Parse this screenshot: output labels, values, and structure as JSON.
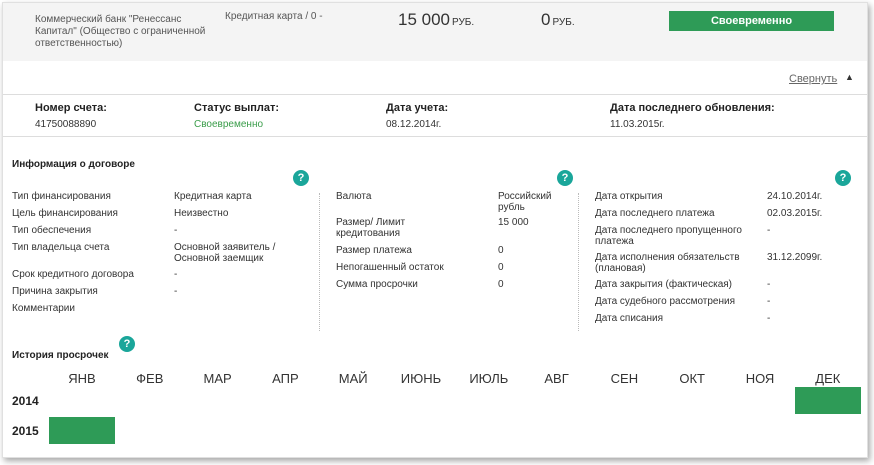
{
  "top": {
    "bank_name": "Коммерческий банк \"Ренессанс Капитал\" (Общество с ограниченной ответственностью)",
    "product": "Кредитная карта / 0 -",
    "limit_value": "15 000",
    "limit_currency": "РУБ.",
    "balance_value": "0",
    "balance_currency": "РУБ.",
    "status_button": "Своевременно"
  },
  "collapse_label": "Свернуть",
  "summary": {
    "account_label": "Номер счета:",
    "account_value": "41750088890",
    "status_label": "Статус выплат:",
    "status_value": "Своевременно",
    "date_label": "Дата учета:",
    "date_value": "08.12.2014г.",
    "updated_label": "Дата последнего обновления:",
    "updated_value": "11.03.2015г."
  },
  "contract": {
    "title": "Информация о договоре",
    "help_glyph": "?",
    "col1": [
      {
        "k": "Тип финансирования",
        "v": "Кредитная карта"
      },
      {
        "k": "Цель финансирования",
        "v": "Неизвестно"
      },
      {
        "k": "Тип обеспечения",
        "v": "-"
      },
      {
        "k": "Тип владельца счета",
        "v": "Основной заявитель / Основной заемщик"
      },
      {
        "k": "Срок кредитного договора",
        "v": "-"
      },
      {
        "k": "Причина закрытия",
        "v": "-"
      },
      {
        "k": "Комментарии",
        "v": ""
      }
    ],
    "col2": [
      {
        "k": "Валюта",
        "v": "Российский рубль"
      },
      {
        "k": "Размер/ Лимит кредитования",
        "v": "15 000"
      },
      {
        "k": "Размер платежа",
        "v": "0"
      },
      {
        "k": "Непогашенный остаток",
        "v": "0"
      },
      {
        "k": "Сумма просрочки",
        "v": "0"
      }
    ],
    "col3": [
      {
        "k": "Дата открытия",
        "v": "24.10.2014г."
      },
      {
        "k": "Дата последнего платежа",
        "v": "02.03.2015г."
      },
      {
        "k": "Дата последнего пропущенного платежа",
        "v": "-"
      },
      {
        "k": "Дата исполнения обязательств (плановая)",
        "v": "31.12.2099г."
      },
      {
        "k": "Дата закрытия (фактическая)",
        "v": "-"
      },
      {
        "k": "Дата судебного рассмотрения",
        "v": "-"
      },
      {
        "k": "Дата списания",
        "v": "-"
      }
    ]
  },
  "history": {
    "title": "История просрочек",
    "months": [
      "ЯНВ",
      "ФЕВ",
      "МАР",
      "АПР",
      "МАЙ",
      "ИЮНЬ",
      "ИЮЛЬ",
      "АВГ",
      "СЕН",
      "ОКТ",
      "НОЯ",
      "ДЕК"
    ],
    "years": [
      {
        "year": "2014",
        "filled_months": [
          12
        ]
      },
      {
        "year": "2015",
        "filled_months": [
          1
        ]
      }
    ],
    "fill_color": "#2e9b57"
  },
  "colors": {
    "accent_green": "#2e9b57",
    "status_text_green": "#3a9d4a",
    "help_teal": "#1aa69a"
  }
}
